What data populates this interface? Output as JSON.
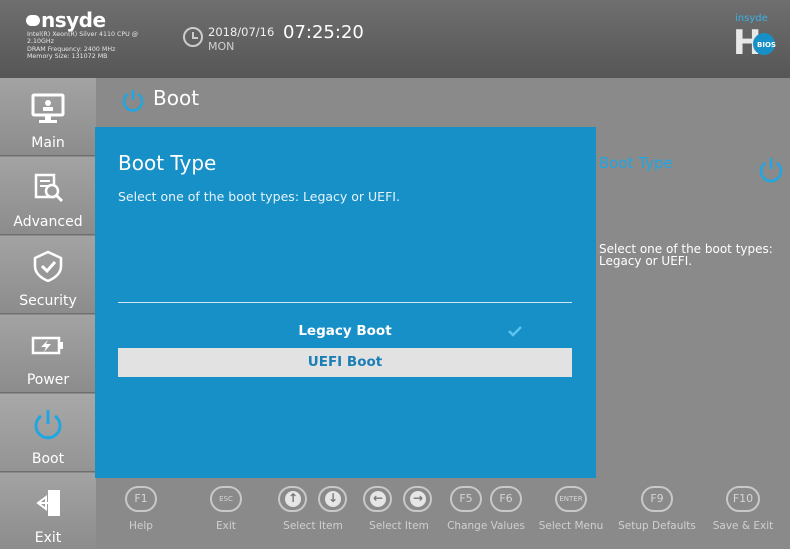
{
  "header": {
    "brand": "nsyde",
    "sysinfo": [
      "Intel(R) Xeon(R) Silver 4110 CPU @",
      "2.10GHz",
      "DRAM Frequency: 2400 MHz",
      "Memory Size: 131072 MB"
    ],
    "date": "2018/07/16",
    "weekday": "MON",
    "time": "07:25:20",
    "badge_top": "insyde",
    "badge_bios": "BIOS"
  },
  "sidebar": {
    "items": [
      {
        "label": "Main",
        "icon": "monitor-icon"
      },
      {
        "label": "Advanced",
        "icon": "chip-magnifier-icon"
      },
      {
        "label": "Security",
        "icon": "shield-icon"
      },
      {
        "label": "Power",
        "icon": "battery-icon"
      },
      {
        "label": "Boot",
        "icon": "power-icon",
        "active": true
      },
      {
        "label": "Exit",
        "icon": "exit-door-icon"
      }
    ]
  },
  "page": {
    "title": "Boot"
  },
  "help": {
    "title": "Boot Type",
    "text": "Select one of the boot types: Legacy or UEFI."
  },
  "dialog": {
    "title": "Boot Type",
    "description": "Select one of the boot types: Legacy or UEFI.",
    "options": [
      {
        "label": "Legacy Boot",
        "checked": true
      },
      {
        "label": "UEFI Boot",
        "highlighted": true
      }
    ]
  },
  "footer": {
    "keys": [
      {
        "key": "F1",
        "caption": "Help"
      },
      {
        "key": "ESC",
        "caption": "Exit"
      },
      {
        "key": "up-down",
        "caption": "Select Item"
      },
      {
        "key": "left-right",
        "caption": "Select Item"
      },
      {
        "key": "F5 F6",
        "caption": "Change Values"
      },
      {
        "key": "ENTER",
        "caption": "Select Menu"
      },
      {
        "key": "F9",
        "caption": "Setup Defaults"
      },
      {
        "key": "F10",
        "caption": "Save & Exit"
      }
    ],
    "key_labels": {
      "f1": "F1",
      "esc": "ESC",
      "f5": "F5",
      "f6": "F6",
      "enter": "ENTER",
      "f9": "F9",
      "f10": "F10"
    }
  },
  "colors": {
    "accent": "#1790c7",
    "highlight_text": "#1fa6e3",
    "selected_row": "#e2e2e2"
  }
}
